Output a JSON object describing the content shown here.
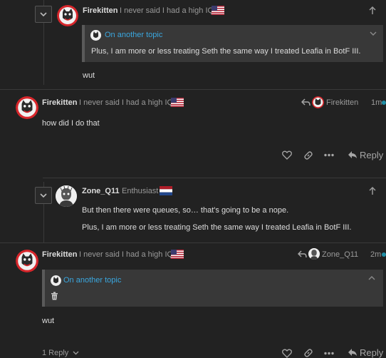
{
  "posts": [
    {
      "username": "Firekitten",
      "user_title": "I never said I had a high IQ",
      "quote_title": "On another topic",
      "quote_text": "Plus, I am more or less treating Seth the same way I treated Leafia in BotF III.",
      "body": "wut"
    },
    {
      "username": "Firekitten",
      "user_title": "I never said I had a high IQ",
      "reply_to_user": "Firekitten",
      "time": "1m",
      "body": "how did I do that",
      "reply_label": "Reply"
    },
    {
      "username": "Zone_Q11",
      "user_title": "Enthusiast",
      "body_lines": [
        "But then there were queues, so… that's going to be a nope.",
        "Plus, I am more or less treating Seth the same way I treated Leafia in BotF III."
      ]
    },
    {
      "username": "Firekitten",
      "user_title": "I never said I had a high IQ",
      "reply_to_user": "Zone_Q11",
      "time": "2m",
      "quote_title": "On another topic",
      "body": "wut",
      "replies_label": "1 Reply",
      "reply_label": "Reply"
    }
  ],
  "colors": {
    "background": "#222222",
    "link": "#3aa7df",
    "quote_bg": "#383838",
    "avatar_red": "#d7262b"
  },
  "icons": [
    "chevron-down-icon",
    "arrow-up-icon",
    "share-icon",
    "heart-icon",
    "link-icon",
    "more-icon",
    "reply-icon",
    "trash-icon",
    "us-flag",
    "nl-flag"
  ]
}
